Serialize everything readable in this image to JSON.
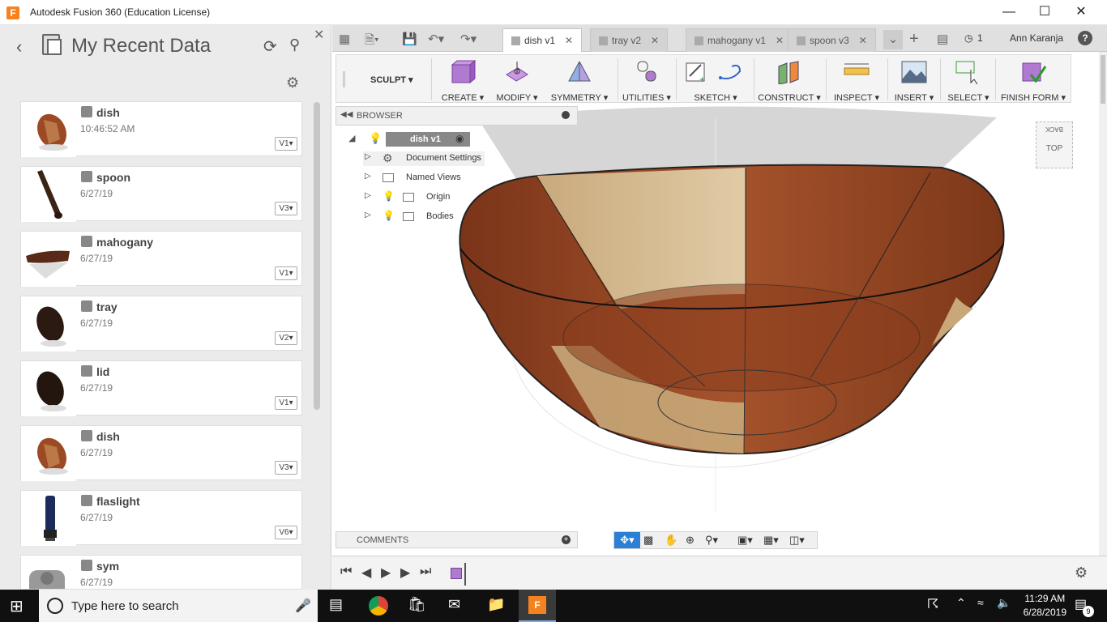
{
  "window": {
    "title": "Autodesk Fusion 360 (Education License)",
    "app_logo": "F"
  },
  "datapanel": {
    "title": "My Recent Data",
    "items": [
      {
        "name": "dish",
        "date": "10:46:52 AM",
        "version": "V1"
      },
      {
        "name": "spoon",
        "date": "6/27/19",
        "version": "V3"
      },
      {
        "name": "mahogany",
        "date": "6/27/19",
        "version": "V1"
      },
      {
        "name": "tray",
        "date": "6/27/19",
        "version": "V2"
      },
      {
        "name": "lid",
        "date": "6/27/19",
        "version": "V1"
      },
      {
        "name": "dish",
        "date": "6/27/19",
        "version": "V3"
      },
      {
        "name": "flaslight",
        "date": "6/27/19",
        "version": "V6"
      },
      {
        "name": "sym",
        "date": "6/27/19",
        "version": ""
      }
    ]
  },
  "tabs": [
    {
      "label": "dish v1",
      "active": true
    },
    {
      "label": "tray v2",
      "active": false
    },
    {
      "label": "mahogany v1",
      "active": false
    },
    {
      "label": "spoon v3",
      "active": false
    }
  ],
  "tabbar_right": {
    "jobs_count": "1",
    "user": "Ann Karanja",
    "help": "?"
  },
  "toolbar": {
    "workspace": "SCULPT",
    "groups": [
      "CREATE",
      "MODIFY",
      "SYMMETRY",
      "UTILITIES",
      "SKETCH",
      "CONSTRUCT",
      "INSPECT",
      "INSERT",
      "SELECT",
      "FINISH FORM"
    ]
  },
  "browser": {
    "title": "BROWSER",
    "root": "dish v1",
    "nodes": [
      "Document Settings",
      "Named Views",
      "Origin",
      "Bodies"
    ]
  },
  "comments": {
    "title": "COMMENTS"
  },
  "viewcube": {
    "face": "TOP",
    "back": "BACK"
  },
  "taskbar": {
    "search_placeholder": "Type here to search",
    "time": "11:29 AM",
    "date": "6/28/2019",
    "notifications": "9"
  },
  "colors": {
    "accent": "#f58220",
    "wood_dark": "#8a3e1f",
    "wood_light": "#d8c29a"
  }
}
